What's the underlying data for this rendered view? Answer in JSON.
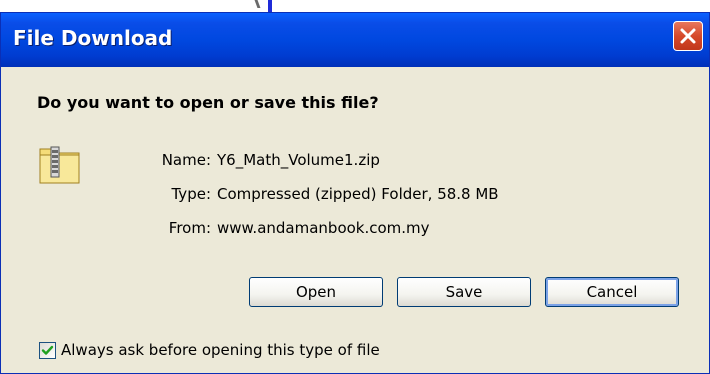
{
  "dialog": {
    "title": "File Download",
    "question": "Do you want to open or save this file?",
    "file_icon": "zip-folder-icon",
    "name_label": "Name:",
    "name_value": "Y6_Math_Volume1.zip",
    "type_label": "Type:",
    "type_value": "Compressed (zipped) Folder, 58.8 MB",
    "from_label": "From:",
    "from_value": "www.andamanbook.com.my",
    "buttons": {
      "open": "Open",
      "save": "Save",
      "cancel": "Cancel"
    },
    "checkbox": {
      "label": "Always ask before opening this type of file",
      "checked": true
    }
  },
  "colors": {
    "titlebar": "#0048e0",
    "close_button": "#d6492a",
    "window_bg": "#ece9d8",
    "checkmark": "#21a121"
  }
}
